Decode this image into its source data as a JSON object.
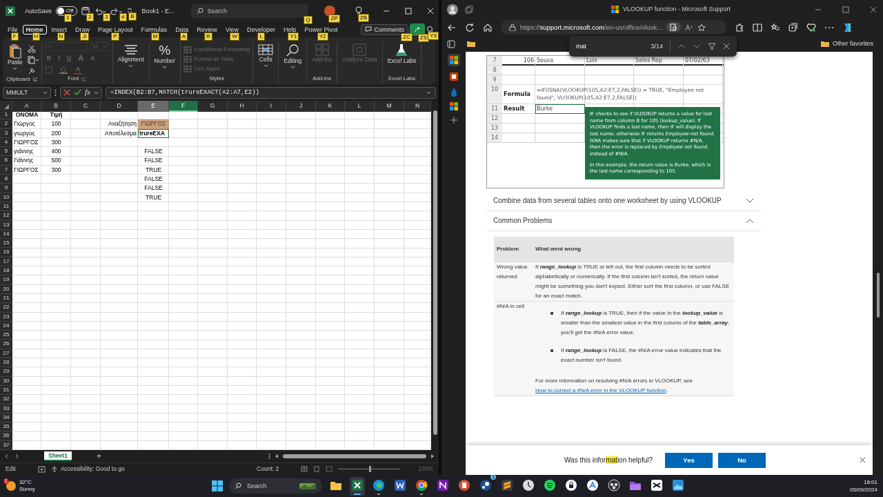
{
  "excel": {
    "autosave": {
      "label": "AutoSave",
      "on": false,
      "state_label": "Off",
      "keytip": "1"
    },
    "quick_access": [
      {
        "kind": "save",
        "keytip": "2"
      },
      {
        "kind": "undo",
        "keytip": "3"
      },
      {
        "kind": "redo",
        "keytip": "4"
      },
      {
        "kind": "customize",
        "keytip": "B"
      }
    ],
    "document_title": "Book1 - E...",
    "search": {
      "placeholder": "Search",
      "keytip": "Q"
    },
    "account": {
      "keytip": "ZP"
    },
    "ideas": {
      "keytip": "ZB"
    },
    "tabs": [
      {
        "label": "File",
        "keytip": "F",
        "selected": false
      },
      {
        "label": "Home",
        "keytip": "H",
        "selected": true
      },
      {
        "label": "Insert",
        "keytip": "N",
        "selected": false
      },
      {
        "label": "Draw",
        "keytip": "JI",
        "selected": false
      },
      {
        "label": "Page Layout",
        "keytip": "P",
        "selected": false
      },
      {
        "label": "Formulas",
        "keytip": "M",
        "selected": false
      },
      {
        "label": "Data",
        "keytip": "A",
        "selected": false
      },
      {
        "label": "Review",
        "keytip": "R",
        "selected": false
      },
      {
        "label": "View",
        "keytip": "W",
        "selected": false
      },
      {
        "label": "Developer",
        "keytip": "L",
        "selected": false
      },
      {
        "label": "Help",
        "keytip": "Y1",
        "selected": false
      },
      {
        "label": "Power Pivot",
        "keytip": "Y2",
        "selected": false
      }
    ],
    "comments": {
      "label": "Comments",
      "keytip": "ZC"
    },
    "share": {
      "keytip": "ZS"
    },
    "ribbon_options": {
      "keytip": "Y3"
    },
    "ribbon": [
      {
        "kind": "clipboard",
        "label": "Clipboard",
        "button": "Paste"
      },
      {
        "kind": "font",
        "label": "Font",
        "font_size": "11",
        "format_buttons": [
          "B",
          "I",
          "U"
        ],
        "size_buttons": [
          "A",
          "A"
        ],
        "color_button": "A",
        "disabled": true
      },
      {
        "kind": "alignment",
        "button": "Alignment",
        "disabled": false
      },
      {
        "kind": "number",
        "glyph": "%",
        "button": "Number",
        "disabled": false
      },
      {
        "kind": "styles",
        "label": "Styles",
        "items": [
          {
            "label": "Conditional Formatting",
            "disabled": true
          },
          {
            "label": "Format as Table",
            "disabled": true
          },
          {
            "label": "Cell Styles",
            "disabled": true
          }
        ]
      },
      {
        "kind": "cells",
        "button": "Cells",
        "disabled": false
      },
      {
        "kind": "editing",
        "button": "Editing",
        "disabled": false
      },
      {
        "kind": "addins",
        "button": "Add-ins",
        "label": "Add-ins",
        "disabled": true
      },
      {
        "kind": "analyze",
        "button": "Analyze Data",
        "disabled": true
      },
      {
        "kind": "labs",
        "button": "Excel Labs",
        "label": "Excel Labs",
        "disabled": false
      }
    ],
    "formula_bar": {
      "name_box": "MMULT",
      "function_glyph": "fx",
      "formula": "=INDEX(B2:B7,MATCH(trureEXACT(A2:A7,E2))"
    },
    "columns": [
      {
        "label": "A",
        "selected": false,
        "referenced": false
      },
      {
        "label": "B",
        "selected": false,
        "referenced": false
      },
      {
        "label": "C",
        "selected": false,
        "referenced": false
      },
      {
        "label": "D",
        "selected": false,
        "referenced": false
      },
      {
        "label": "E",
        "selected": false,
        "referenced": true
      },
      {
        "label": "F",
        "selected": true,
        "referenced": false
      },
      {
        "label": "G",
        "selected": false,
        "referenced": false
      },
      {
        "label": "H",
        "selected": false,
        "referenced": false
      },
      {
        "label": "I",
        "selected": false,
        "referenced": false
      },
      {
        "label": "J",
        "selected": false,
        "referenced": false
      },
      {
        "label": "K",
        "selected": false,
        "referenced": false
      },
      {
        "label": "L",
        "selected": false,
        "referenced": false
      },
      {
        "label": "M",
        "selected": false,
        "referenced": false
      },
      {
        "label": "N",
        "selected": false,
        "referenced": false
      }
    ],
    "rows": [
      {
        "number": "1",
        "cells": [
          {
            "text": "ΟΝΟΜΑ",
            "kind": "header"
          },
          {
            "text": "Τιμή",
            "kind": "header"
          }
        ]
      },
      {
        "number": "2",
        "cells": [
          {
            "text": "Γιώργος",
            "kind": "text"
          },
          {
            "text": "100",
            "kind": "number"
          },
          null,
          {
            "text": "Αναζήτηση",
            "kind": "label"
          },
          {
            "text": "ΓΙΩΡΓΟΣ",
            "kind": "reference"
          }
        ]
      },
      {
        "number": "3",
        "cells": [
          {
            "text": "γιωργος",
            "kind": "text"
          },
          {
            "text": "200",
            "kind": "number"
          },
          null,
          {
            "text": "Αποτέλεσμα",
            "kind": "label"
          },
          {
            "text": "trureEXA",
            "kind": "editing"
          }
        ]
      },
      {
        "number": "4",
        "cells": [
          {
            "text": "ΓΙΩΡΓΟΣ",
            "kind": "text"
          },
          {
            "text": "300",
            "kind": "number"
          }
        ]
      },
      {
        "number": "5",
        "cells": [
          {
            "text": "γιάννης",
            "kind": "text"
          },
          {
            "text": "400",
            "kind": "number"
          },
          null,
          null,
          {
            "text": "FALSE",
            "kind": "boolean"
          }
        ]
      },
      {
        "number": "6",
        "cells": [
          {
            "text": "Γιάννης",
            "kind": "text"
          },
          {
            "text": "500",
            "kind": "number"
          },
          null,
          null,
          {
            "text": "FALSE",
            "kind": "boolean"
          }
        ]
      },
      {
        "number": "7",
        "cells": [
          {
            "text": "ΓΙΩΡΓΟΣ",
            "kind": "text"
          },
          {
            "text": "300",
            "kind": "number"
          },
          null,
          null,
          {
            "text": "TRUE",
            "kind": "boolean"
          }
        ]
      },
      {
        "number": "8",
        "cells": [
          null,
          null,
          null,
          null,
          {
            "text": "FALSE",
            "kind": "boolean"
          }
        ]
      },
      {
        "number": "9",
        "cells": [
          null,
          null,
          null,
          null,
          {
            "text": "FALSE",
            "kind": "boolean"
          }
        ]
      },
      {
        "number": "10",
        "cells": [
          null,
          null,
          null,
          null,
          {
            "text": "TRUE",
            "kind": "boolean"
          }
        ]
      },
      {
        "number": "11"
      },
      {
        "number": "12"
      },
      {
        "number": "13"
      },
      {
        "number": "14"
      },
      {
        "number": "15"
      },
      {
        "number": "16"
      },
      {
        "number": "17"
      },
      {
        "number": "18"
      },
      {
        "number": "19"
      },
      {
        "number": "20"
      },
      {
        "number": "21"
      },
      {
        "number": "22"
      },
      {
        "number": "23"
      },
      {
        "number": "24"
      },
      {
        "number": "25"
      },
      {
        "number": "26"
      },
      {
        "number": "27"
      },
      {
        "number": "28"
      },
      {
        "number": "29"
      },
      {
        "number": "30"
      },
      {
        "number": "31"
      },
      {
        "number": "32"
      },
      {
        "number": "33"
      },
      {
        "number": "34"
      },
      {
        "number": "35"
      },
      {
        "number": "36"
      },
      {
        "number": "37"
      }
    ],
    "sheet_tabs": [
      {
        "label": "Sheet1",
        "selected": true
      }
    ],
    "add_sheet": "+",
    "status_bar": {
      "mode": "Edit",
      "accessibility": "Accessibility: Good to go",
      "count": "Count: 2",
      "zoom": {
        "level": 0.5,
        "label": "100%"
      }
    }
  },
  "browser": {
    "tab_title": "VLOOKUP function - Microsoft Support",
    "url": {
      "scheme": "https://",
      "host": "support.microsoft.com",
      "path": "/en-us/office/vlook..."
    },
    "favorites_folder": "Other favorites",
    "find": {
      "query": "mat",
      "count": "3/14"
    },
    "example": {
      "rows": [
        {
          "number": "7",
          "cells": [
            "106",
            "Sousa",
            "Luis",
            "Sales Rep",
            "07/02/63"
          ]
        },
        {
          "number": "8"
        },
        {
          "number": "9"
        },
        {
          "number": "10",
          "label": "Formula",
          "formula": "=IF(ISNA(VLOOKUP(105,A2:E7,2,FALSE)) = TRUE, \"Employee not found\", VLOOKUP(105,A2:E7,2,FALSE))"
        },
        {
          "number": "11",
          "label": "Result",
          "value": "Burke"
        },
        {
          "number": "12"
        },
        {
          "number": "13"
        },
        {
          "number": "14"
        }
      ],
      "callout": [
        "IF checks to see if VLOOKUP returns a value for last name from column B for 105 (lookup_value). If VLOOKUP finds a last name, then IF will display the last name, otherwise IF returns *Employee not found*. ISNA makes sure that if VLOOKUP returns #N/A, then the error is replaced by *Employee not found*, instead of #N/A.",
        "In this example, the return value is *Burke*, which is the last name corresponding to 105."
      ]
    },
    "sections": [
      {
        "title": "Combine data from several tables onto one worksheet by using VLOOKUP",
        "expanded": false
      },
      {
        "title": "Common Problems",
        "expanded": true
      }
    ],
    "problems": {
      "columns": [
        "Problem",
        "What went wrong"
      ],
      "rows": [
        {
          "problem": "Wrong value returned",
          "paragraphs": [
            "If **range_lookup** is TRUE or left out, the first column needs to be sorted alphabetically or numerically. If the first column isn't sorted, the return value might be something you don't expect. Either sort the first column, or use FALSE for an exact match."
          ]
        },
        {
          "problem": "#N/A in cell",
          "bullets": [
            "If **range_lookup** is TRUE, then if the value in the **lookup_value** is smaller than the smallest value in the first column of the **table_array**, you'll get the #N/A error value.",
            "If **range_lookup** is FALSE, the #N/A error value indicates that the exact number isn't found."
          ],
          "note": "For more information on resolving #N/A errors in VLOOKUP, see",
          "link": "How to correct a #N/A error in the VLOOKUP function",
          "note_end": "."
        }
      ]
    },
    "feedback": {
      "before": "Was this infor",
      "match": "mat",
      "after": "ion helpful?",
      "yes": "Yes",
      "no": "No"
    }
  },
  "taskbar": {
    "weather": {
      "badge": "1",
      "temperature": "32°C",
      "condition": "Sunny"
    },
    "search": "Search",
    "apps": [
      {
        "kind": "explorer",
        "running": false,
        "active": false
      },
      {
        "kind": "excel",
        "running": true,
        "active": true
      },
      {
        "kind": "edge",
        "running": true,
        "active": false
      },
      {
        "kind": "word",
        "running": false,
        "active": false
      },
      {
        "kind": "chrome",
        "running": true,
        "active": false
      },
      {
        "kind": "onenote",
        "running": false,
        "active": false
      },
      {
        "kind": "powerpoint",
        "running": false,
        "active": false
      },
      {
        "kind": "steam",
        "running": false,
        "active": false,
        "badge": "1"
      },
      {
        "kind": "sublime",
        "running": false,
        "active": false
      },
      {
        "kind": "clock",
        "running": false,
        "active": false
      },
      {
        "kind": "spotify",
        "running": false,
        "active": false
      },
      {
        "kind": "lock",
        "running": false,
        "active": false
      },
      {
        "kind": "store",
        "running": false,
        "active": false
      },
      {
        "kind": "obs",
        "running": false,
        "active": false
      },
      {
        "kind": "purple",
        "running": false,
        "active": false
      },
      {
        "kind": "capcut",
        "running": false,
        "active": false
      },
      {
        "kind": "blue",
        "running": false,
        "active": false
      }
    ],
    "time": "18:01",
    "date": "05/09/2024"
  }
}
